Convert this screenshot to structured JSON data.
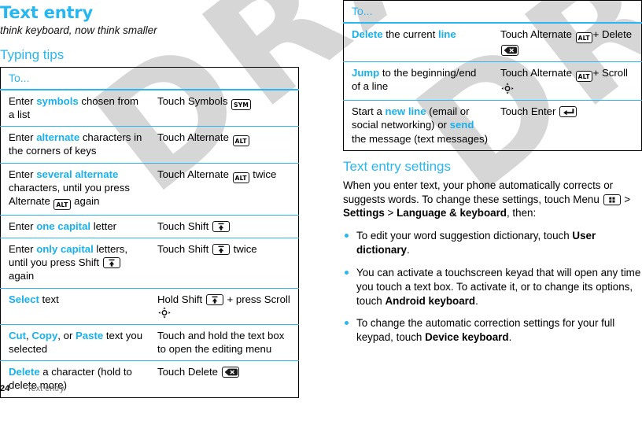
{
  "chapter": {
    "title": "Text entry",
    "subtitle": "think keyboard, now think smaller"
  },
  "watermark": {
    "text": "DRAFT"
  },
  "footer": {
    "page_number": "24",
    "section_name": "Text entry"
  },
  "typing_tips": {
    "heading": "Typing tips",
    "column_header": "To...",
    "rows": [
      {
        "task": {
          "pre": "Enter ",
          "hl": "symbols",
          "post": " chosen from a list"
        },
        "action": {
          "pre": "Touch Symbols ",
          "icon": "sym-key-icon",
          "post": ""
        }
      },
      {
        "task": {
          "pre": "Enter ",
          "hl": "alternate",
          "post": " characters in the corners of keys"
        },
        "action": {
          "pre": "Touch Alternate ",
          "icon": "alt-key-icon",
          "post": ""
        }
      },
      {
        "task": {
          "pre": "Enter ",
          "hl": "several alternate",
          "post": " characters, until you press Alternate ",
          "icon": "alt-key-icon",
          "tail": " again"
        },
        "action": {
          "pre": "Touch Alternate ",
          "icon": "alt-key-icon",
          "post": " twice"
        }
      },
      {
        "task": {
          "pre": "Enter ",
          "hl": "one capital",
          "post": " letter"
        },
        "action": {
          "pre": "Touch Shift ",
          "icon": "shift-key-icon",
          "post": ""
        }
      },
      {
        "task": {
          "pre": "Enter ",
          "hl": "only capital",
          "post": " letters, until you press Shift ",
          "icon": "shift-key-icon",
          "tail": " again"
        },
        "action": {
          "pre": "Touch Shift ",
          "icon": "shift-key-icon",
          "post": " twice"
        }
      },
      {
        "task": {
          "pre": "",
          "hl": "Select",
          "post": " text"
        },
        "action": {
          "pre": "Hold Shift ",
          "icon": "shift-key-icon",
          "post": " + press Scroll ",
          "icon2": "scroll-nav-icon"
        }
      },
      {
        "task": {
          "pre": "",
          "hl": "Cut",
          "mid1": ", ",
          "hl2": "Copy",
          "mid2": ", or ",
          "hl3": "Paste",
          "post": " text you selected"
        },
        "action": {
          "pre": "Touch and hold the text box to open the editing menu",
          "icon": "",
          "post": ""
        }
      },
      {
        "task": {
          "pre": "",
          "hl": "Delete",
          "post": " a character (hold to delete more)"
        },
        "action": {
          "pre": "Touch Delete ",
          "icon": "delete-key-icon",
          "post": ""
        }
      }
    ]
  },
  "typing_tips_continued": {
    "column_header": "To...",
    "rows": [
      {
        "task": {
          "pre": "",
          "hl": "Delete",
          "post": " the current ",
          "hl2": "line"
        },
        "action": {
          "pre": "Touch Alternate ",
          "icon": "alt-key-icon",
          "post": "+ Delete ",
          "icon2": "delete-key-icon"
        }
      },
      {
        "task": {
          "pre": "",
          "hl": "Jump",
          "post": " to the beginning/end of a line"
        },
        "action": {
          "pre": "Touch Alternate ",
          "icon": "alt-key-icon",
          "post": "+ Scroll ",
          "icon2": "scroll-nav-icon"
        }
      },
      {
        "task": {
          "pre": "Start a ",
          "hl": "new line",
          "post": " (email or social networking) or ",
          "hl2": "send",
          "tail": " the message (text messages)"
        },
        "action": {
          "pre": "Touch Enter ",
          "icon": "enter-key-icon",
          "post": ""
        }
      }
    ]
  },
  "text_entry_settings": {
    "heading": "Text entry settings",
    "intro_1": "When you enter text, your phone automatically corrects or suggests words. To change these settings, touch Menu ",
    "menu_icon": "menu-key-icon",
    "intro_2": " > ",
    "path_1": "Settings",
    "intro_3": " > ",
    "path_2": "Language & keyboard",
    "intro_4": ", then:",
    "bullets": [
      {
        "pre": "To edit your word suggestion dictionary, touch ",
        "bold": "User dictionary",
        "post": "."
      },
      {
        "pre": "You can activate a touchscreen keyad that will open any time you touch a text box. To activate it, or to change its options, touch ",
        "bold": "Android keyboard",
        "post": "."
      },
      {
        "pre": "To change the automatic correction settings for your full keypad, touch ",
        "bold": "Device keyboard",
        "post": "."
      }
    ]
  },
  "colors": {
    "accent_cyan": "#2ab6f0",
    "highlight_cyan": "#19b0ec",
    "text_black": "#000000",
    "footer_gray": "#6f6f6f",
    "watermark_gray": "#d6d6d6"
  }
}
